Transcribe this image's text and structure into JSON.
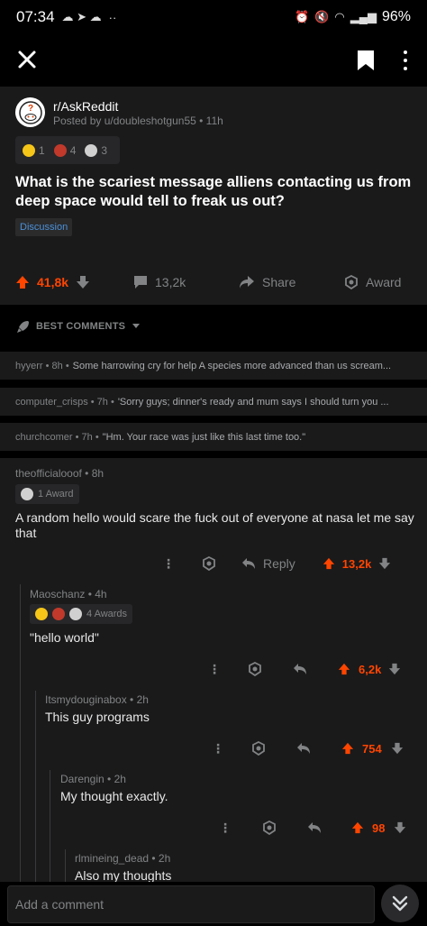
{
  "status_bar": {
    "time": "07:34",
    "battery": "96%",
    "left_extra": "··"
  },
  "post": {
    "subreddit": "r/AskReddit",
    "posted_by": "Posted by u/doubleshotgun55 • 11h",
    "awards": [
      {
        "name": "wholesome-award",
        "count": "1",
        "color": "#f5c518"
      },
      {
        "name": "gold-award",
        "count": "4",
        "color": "#c0392b"
      },
      {
        "name": "silver-award",
        "count": "3",
        "color": "#d0d0d0"
      }
    ],
    "title": "What is the scariest message alliens contacting us from deep space would tell to freak us out?",
    "flair": "Discussion",
    "score": "41,8k",
    "comments_count": "13,2k",
    "share_label": "Share",
    "award_label": "Award"
  },
  "sort": {
    "label": "BEST COMMENTS"
  },
  "collapsed_comments": [
    {
      "meta": "hyyerr • 8h • ",
      "body": "Some harrowing cry for help  A species more advanced than us scream..."
    },
    {
      "meta": "computer_crisps • 7h • ",
      "body": "'Sorry guys; dinner's ready and mum says I should turn you ..."
    },
    {
      "meta": "churchcomer • 7h • ",
      "body": "\"Hm. Your race was just like this last time too.\""
    }
  ],
  "comments": [
    {
      "author": "theofficialooof • 8h",
      "awards_label": "1 Award",
      "text": "A random hello would scare the fuck out of everyone at nasa let me say that",
      "reply_label": "Reply",
      "score": "13,2k"
    },
    {
      "author": "Maoschanz • 4h",
      "awards_label": "4 Awards",
      "text": "\"hello world\"",
      "score": "6,2k"
    },
    {
      "author": "Itsmydouginabox • 2h",
      "text": "This guy programs",
      "score": "754"
    },
    {
      "author": "Darengin • 2h",
      "text": "My thought exactly.",
      "score": "98"
    },
    {
      "author": "rlmineing_dead • 2h",
      "text": "Also my thoughts"
    }
  ],
  "comment_input": {
    "placeholder": "Add a comment"
  },
  "colors": {
    "upvote": "#ff4500",
    "background": "#1a1a1b",
    "flair": "#4a90d9"
  }
}
